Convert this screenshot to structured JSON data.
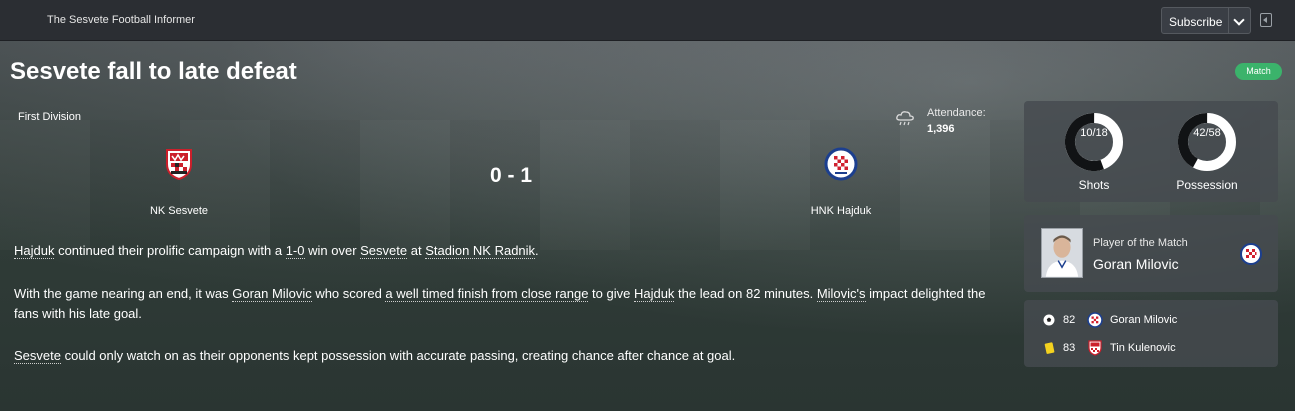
{
  "publication": {
    "name": "The Sesvete Football Informer"
  },
  "subscribe": {
    "label": "Subscribe"
  },
  "article": {
    "headline": "Sesvete fall to late defeat",
    "badge": "Match",
    "paragraphs": [
      [
        "Hajduk",
        " continued their prolific campaign with a ",
        "1-0",
        " win over ",
        "Sesvete",
        " at ",
        "Stadion NK Radnik",
        "."
      ],
      [
        "With the game nearing an end, it was ",
        "Goran Milovic",
        " who scored ",
        "a well timed finish from close range",
        " to give ",
        "Hajduk",
        " the lead on 82 minutes. ",
        "Milovic's",
        " impact delighted the fans with his late goal."
      ],
      [
        "Sesvete",
        " could only watch on as their opponents kept possession with accurate passing, creating chance after chance at goal."
      ]
    ]
  },
  "match": {
    "competition": "First Division",
    "attendance_label": "Attendance:",
    "attendance_value": "1,396",
    "score": "0 - 1",
    "home_team": "NK Sesvete",
    "away_team": "HNK Hajduk",
    "weather_icon": "cloud-rain-icon"
  },
  "stats": {
    "shots": {
      "label": "Shots",
      "text": "10/18",
      "fraction": 0.5556
    },
    "possession": {
      "label": "Possession",
      "text": "42/58",
      "fraction": 0.42
    }
  },
  "potm": {
    "label": "Player of the Match",
    "name": "Goran Milovic"
  },
  "events": [
    {
      "icon": "football-icon",
      "minute": "82",
      "player": "Goran Milovic",
      "team": "away"
    },
    {
      "icon": "yellow-card-icon",
      "minute": "83",
      "player": "Tin Kulenovic",
      "team": "home"
    }
  ],
  "colors": {
    "badge": "#3bb36b",
    "home_red": "#cc1f2b",
    "away_blue": "#1c3f8f",
    "yellow_card": "#f4d21f"
  }
}
